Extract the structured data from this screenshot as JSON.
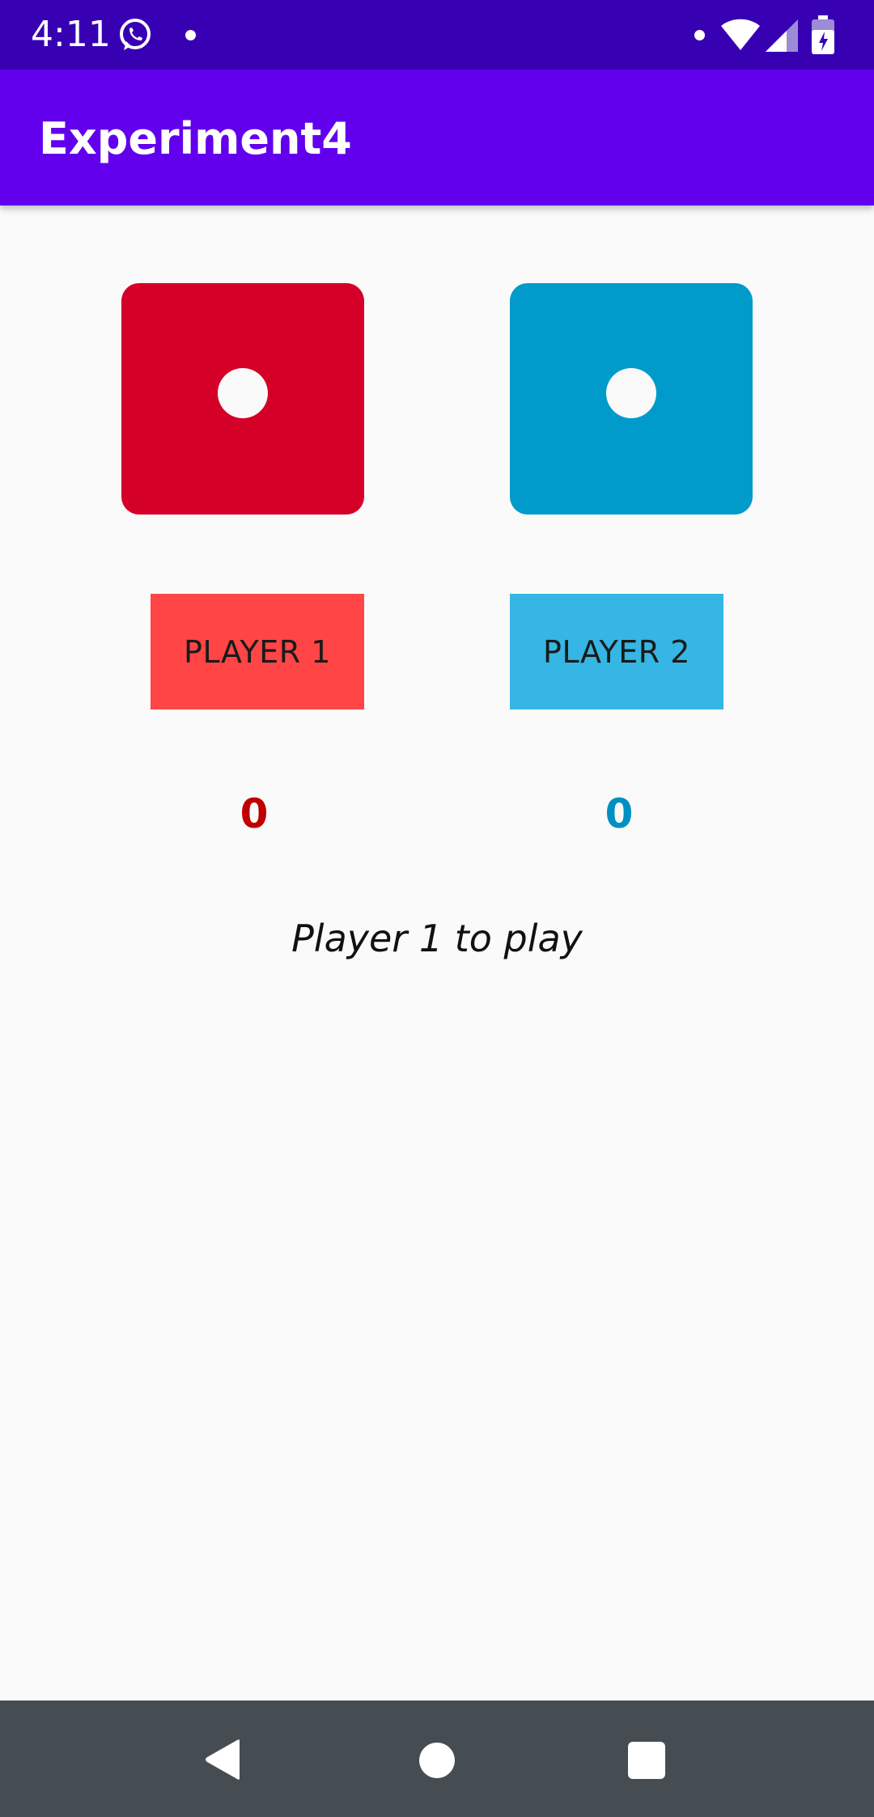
{
  "status_bar": {
    "time": "4:11",
    "left_icons": [
      "whatsapp-icon",
      "notification-dot-icon"
    ],
    "right_icons": [
      "notification-dot-icon",
      "wifi-icon",
      "signal-icon",
      "battery-icon"
    ]
  },
  "app_bar": {
    "title": "Experiment4"
  },
  "dice": {
    "player1": {
      "face_value": 1,
      "color": "#d50027"
    },
    "player2": {
      "face_value": 1,
      "color": "#009bcb"
    }
  },
  "buttons": {
    "player1_label": "PLAYER 1",
    "player2_label": "PLAYER 2",
    "player1_color": "#ff4545",
    "player2_color": "#35b6e4"
  },
  "scores": {
    "player1": "0",
    "player2": "0",
    "player1_color": "#c00000",
    "player2_color": "#0090c4"
  },
  "turn_status": "Player 1 to play",
  "nav_bar": {
    "icons": [
      "back-icon",
      "home-icon",
      "recents-icon"
    ]
  },
  "colors": {
    "status_bar": "#3700b3",
    "app_bar": "#6200ee",
    "background": "#fafafa",
    "nav_bar": "#454c52"
  }
}
